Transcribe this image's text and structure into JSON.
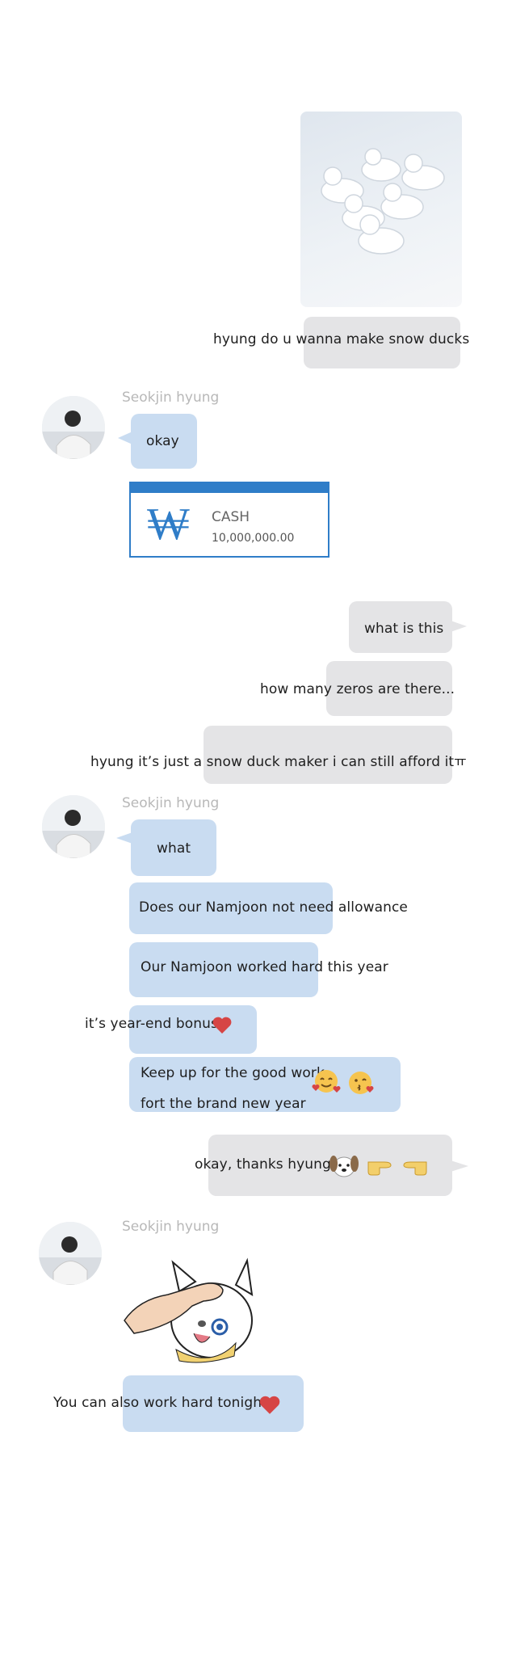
{
  "contact": {
    "name": "Seokjin hyung"
  },
  "messages": {
    "m1_image": "snow ducks photo",
    "m1_text": "hyung do u wanna make snow ducks",
    "m2_text": "okay",
    "cash": {
      "symbol": "₩",
      "label": "CASH",
      "amount": "10,000,000.00"
    },
    "m3_text": "what is this",
    "m4_text": "how many zeros are there...",
    "m5_text": "hyung it’s just a snow duck maker i can still afford itㅠ",
    "m6_text": "what",
    "m7_text": "Does our Namjoon not need allowance",
    "m8_text": "Our Namjoon worked hard this year",
    "m9_text": "it’s year-end bonus",
    "m10_line1": "Keep up for the good work",
    "m10_line2": "fort the brand new year",
    "m11_text": "okay, thanks hyung",
    "m12_sticker": "dog sticker being patted",
    "m13_text": "You can also work hard tonight"
  },
  "icons": {
    "heart": "red-heart-icon",
    "smile_hearts": "smiling-face-with-hearts-icon",
    "kiss": "face-blowing-kiss-icon",
    "dog": "dog-face-icon",
    "point_right": "pointing-right-icon",
    "point_left": "pointing-left-icon"
  },
  "colors": {
    "my_bubble": "#e4e4e6",
    "his_bubble": "#c9dcf1",
    "name_text": "#b8b8b8",
    "cash_blue": "#2f7dc8"
  }
}
